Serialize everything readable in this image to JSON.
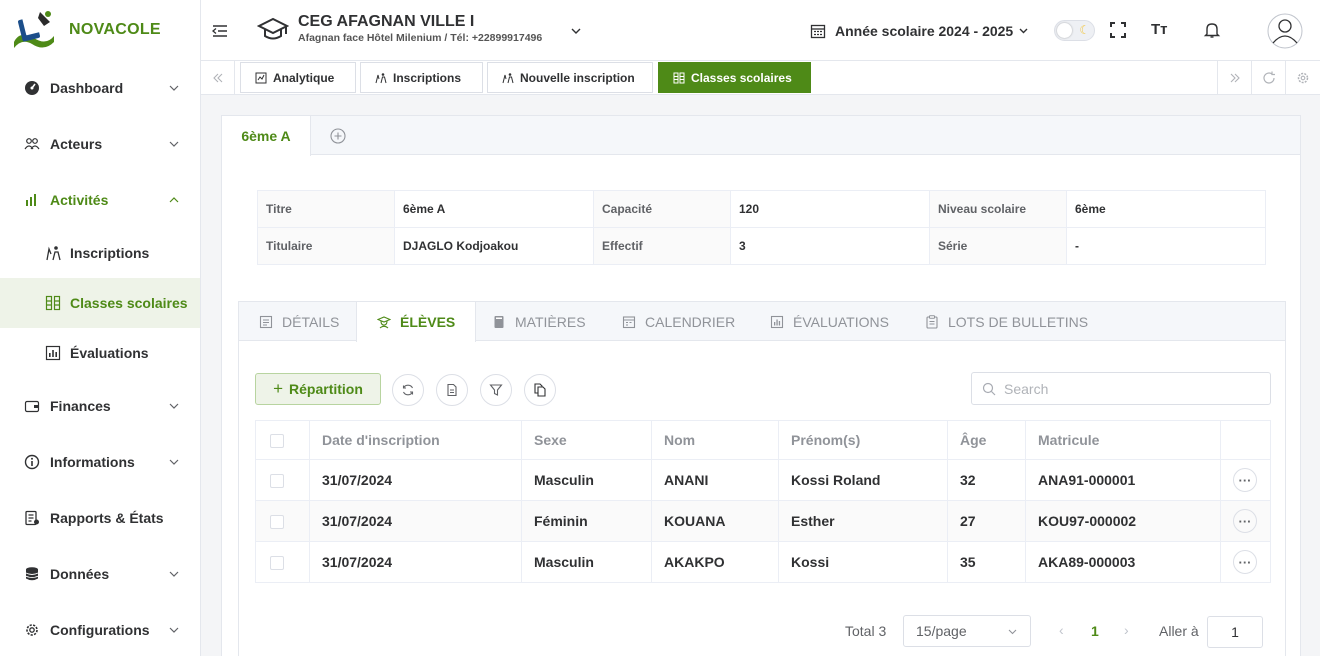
{
  "app": {
    "name": "NOVACOLE"
  },
  "sidebar": {
    "items": [
      {
        "label": "Dashboard",
        "icon": "gauge-icon"
      },
      {
        "label": "Acteurs",
        "icon": "users-icon"
      },
      {
        "label": "Activités",
        "icon": "bar-chart-icon"
      },
      {
        "label": "Finances",
        "icon": "wallet-icon"
      },
      {
        "label": "Informations",
        "icon": "info-icon"
      },
      {
        "label": "Rapports & États",
        "icon": "report-icon"
      },
      {
        "label": "Données",
        "icon": "database-icon"
      },
      {
        "label": "Configurations",
        "icon": "gear-icon"
      }
    ],
    "sub_items": [
      {
        "label": "Inscriptions",
        "icon": "enroll-icon"
      },
      {
        "label": "Classes scolaires",
        "icon": "classes-icon"
      },
      {
        "label": "Évaluations",
        "icon": "chart-icon"
      }
    ]
  },
  "header": {
    "school_name": "CEG AFAGNAN VILLE I",
    "school_address": "Afagnan face Hôtel Milenium / Tél: +22899917496",
    "school_year": "Année scolaire 2024 - 2025",
    "font_icon_text": "Tт"
  },
  "page_tabs": [
    {
      "label": "Analytique"
    },
    {
      "label": "Inscriptions"
    },
    {
      "label": "Nouvelle inscription"
    },
    {
      "label": "Classes scolaires"
    }
  ],
  "class_tab": {
    "label": "6ème A"
  },
  "class_info": {
    "titre_label": "Titre",
    "titre": "6ème A",
    "capacite_label": "Capacité",
    "capacite": "120",
    "niveau_label": "Niveau scolaire",
    "niveau": "6ème",
    "titulaire_label": "Titulaire",
    "titulaire": "DJAGLO Kodjoakou",
    "effectif_label": "Effectif",
    "effectif": "3",
    "serie_label": "Série",
    "serie": "-"
  },
  "section_tabs": [
    {
      "label": "DÉTAILS"
    },
    {
      "label": "ÉLÈVES"
    },
    {
      "label": "MATIÈRES"
    },
    {
      "label": "CALENDRIER"
    },
    {
      "label": "ÉVALUATIONS"
    },
    {
      "label": "LOTS DE BULLETINS"
    }
  ],
  "toolbar": {
    "repartition_label": "Répartition"
  },
  "search": {
    "placeholder": "Search",
    "value": ""
  },
  "table": {
    "columns": [
      "Date d'inscription",
      "Sexe",
      "Nom",
      "Prénom(s)",
      "Âge",
      "Matricule"
    ],
    "rows": [
      {
        "date": "31/07/2024",
        "sexe": "Masculin",
        "nom": "ANANI",
        "prenoms": "Kossi Roland",
        "age": "32",
        "matricule": "ANA91-000001"
      },
      {
        "date": "31/07/2024",
        "sexe": "Féminin",
        "nom": "KOUANA",
        "prenoms": "Esther",
        "age": "27",
        "matricule": "KOU97-000002"
      },
      {
        "date": "31/07/2024",
        "sexe": "Masculin",
        "nom": "AKAKPO",
        "prenoms": "Kossi",
        "age": "35",
        "matricule": "AKA89-000003"
      }
    ],
    "more_label": "···"
  },
  "pagination": {
    "total_label": "Total 3",
    "page_size": "15/page",
    "current_page": "1",
    "goto_label": "Aller à",
    "goto_value": "1",
    "prev_symbol": "‹",
    "next_symbol": "›"
  },
  "colors": {
    "accent": "#4e8a17",
    "accent_light": "#eef3e8"
  }
}
